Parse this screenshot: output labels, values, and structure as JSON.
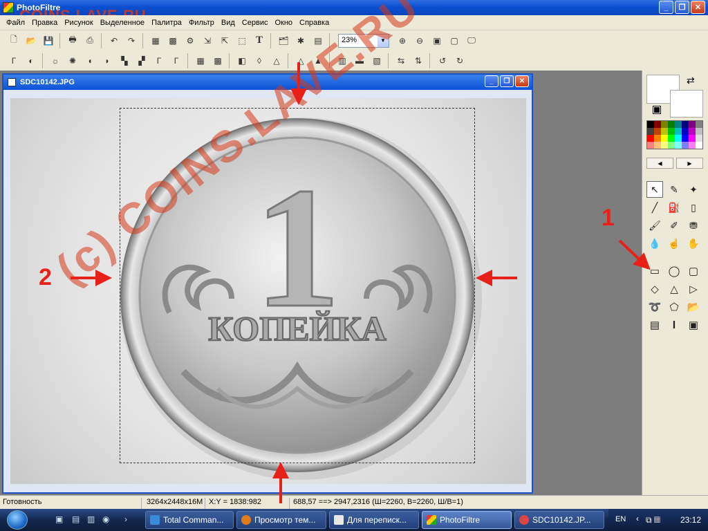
{
  "app": {
    "title": "PhotoFiltre",
    "watermark_top": "COINS.LAVE.RU"
  },
  "menu": [
    "Файл",
    "Правка",
    "Рисунок",
    "Выделенное",
    "Палитра",
    "Фильтр",
    "Вид",
    "Сервис",
    "Окно",
    "Справка"
  ],
  "toolbar": {
    "zoom_value": "23%"
  },
  "document": {
    "title": "SDC10142.JPG"
  },
  "coin": {
    "denomination": "1",
    "word": "КОПЕЙКА"
  },
  "watermark_diag": "(c) COINS.LAVE.RU",
  "annotations": {
    "label_1": "1",
    "label_2": "2"
  },
  "status": {
    "state": "Готовность",
    "image_info": "3264x2448x16M",
    "coords": "X:Y = 1838:982",
    "selection": "688,57 ==> 2947,2316 (Ш=2260, В=2260, Ш/В=1)"
  },
  "taskbar": {
    "tasks": [
      "Total Comman...",
      "Просмотр тем...",
      "Для переписк...",
      "PhotoFiltre",
      "SDC10142.JP..."
    ],
    "lang": "EN",
    "clock": "23:12"
  },
  "colors": {
    "accent": "#0a4fd0",
    "annotation": "#e8201a"
  }
}
